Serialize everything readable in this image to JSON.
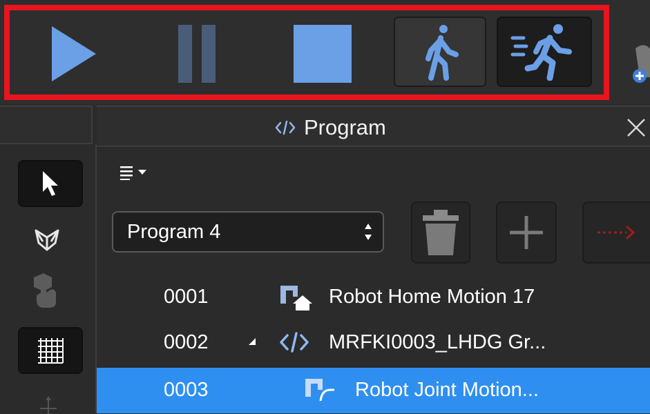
{
  "toolbar": {
    "buttons": [
      {
        "name": "play",
        "icon": "play-icon"
      },
      {
        "name": "pause",
        "icon": "pause-icon"
      },
      {
        "name": "stop",
        "icon": "stop-icon"
      },
      {
        "name": "walk-speed",
        "icon": "walking-person-icon"
      },
      {
        "name": "run-speed",
        "icon": "running-person-icon"
      }
    ],
    "highlight_color": "#e8141e",
    "accent_color": "#6b9fe6"
  },
  "left_toolbar": {
    "tools": [
      "cursor-icon",
      "snap-icon",
      "hand-icon",
      "grid-icon",
      "move-icon"
    ]
  },
  "panel": {
    "title": "Program",
    "title_icon": "code-tag-icon",
    "close_icon": "close-icon",
    "list_menu_icon": "list-menu-icon",
    "program_select": {
      "value": "Program 4"
    },
    "actions": [
      "trash-icon",
      "plus-icon",
      "call-program-icon"
    ]
  },
  "program": {
    "rows": [
      {
        "number": "0001",
        "icon": "robot-home-icon",
        "label": "Robot Home Motion 17",
        "selected": false
      },
      {
        "number": "0002",
        "icon": "code-tag-icon",
        "label": "MRFKI0003_LHDG Gr...",
        "expanded": true,
        "selected": false
      },
      {
        "number": "0003",
        "icon": "robot-joint-icon",
        "label": "Robot Joint Motion...",
        "selected": true
      }
    ],
    "selection_color": "#2f8ff0"
  }
}
